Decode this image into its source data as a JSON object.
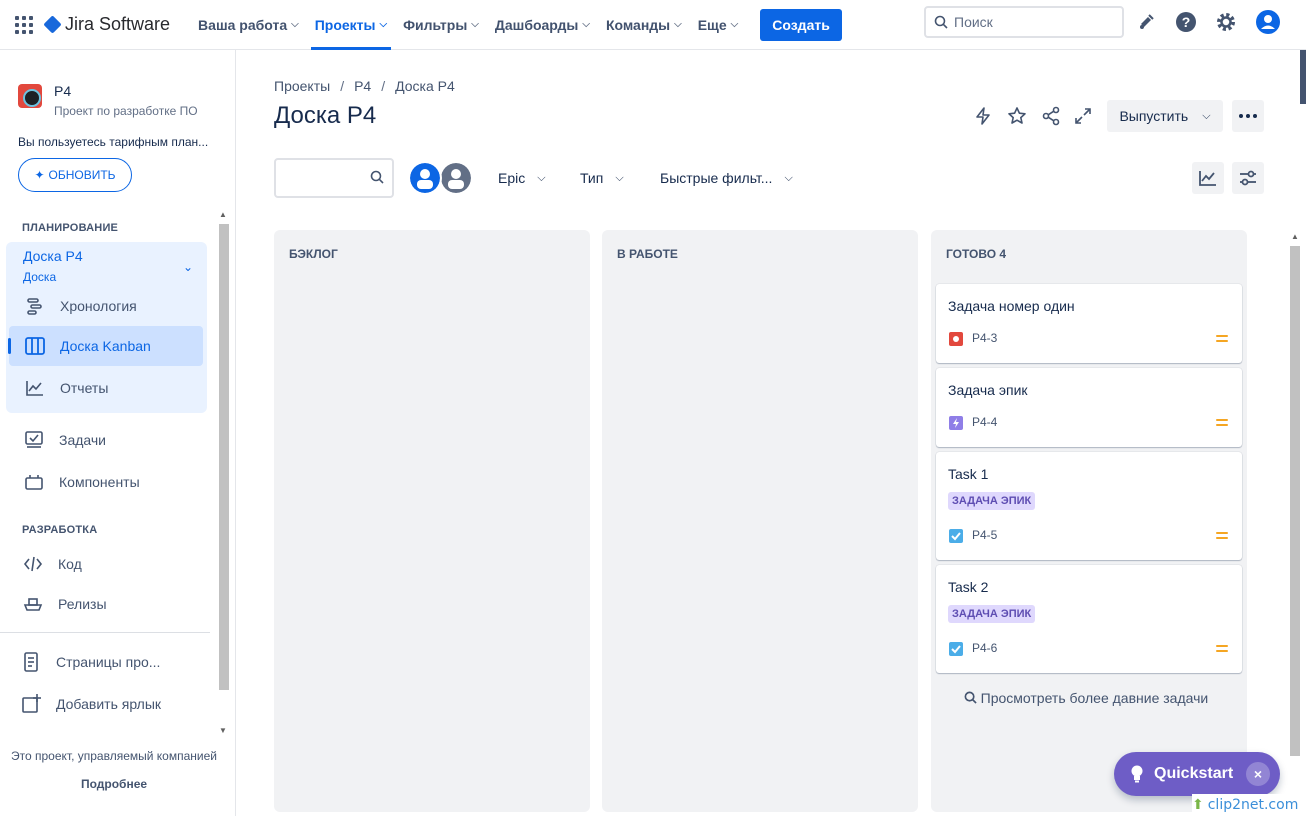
{
  "topnav": {
    "brand": "Jira Software",
    "menu": [
      {
        "label": "Ваша работа",
        "active": false
      },
      {
        "label": "Проекты",
        "active": true
      },
      {
        "label": "Фильтры",
        "active": false
      },
      {
        "label": "Дашбоарды",
        "active": false
      },
      {
        "label": "Команды",
        "active": false
      },
      {
        "label": "Еще",
        "active": false
      }
    ],
    "create_label": "Создать",
    "search_placeholder": "Поиск",
    "accent": "#0c66e4"
  },
  "sidebar": {
    "project_name": "P4",
    "project_type": "Проект по разработке ПО",
    "plan_note": "Вы пользуетесь тарифным план...",
    "upgrade_label": "ОБНОВИТЬ",
    "planning_label": "ПЛАНИРОВАНИЕ",
    "board_title": "Доска P4",
    "board_sub": "Доска",
    "planning_items": [
      {
        "label": "Хронология",
        "icon": "timeline-icon"
      },
      {
        "label": "Доска Kanban",
        "icon": "board-icon",
        "selected": true
      },
      {
        "label": "Отчеты",
        "icon": "reports-icon"
      }
    ],
    "other_items": [
      {
        "label": "Задачи",
        "icon": "issues-icon"
      },
      {
        "label": "Компоненты",
        "icon": "components-icon"
      }
    ],
    "development_label": "РАЗРАБОТКА",
    "dev_items": [
      {
        "label": "Код",
        "icon": "code-icon"
      },
      {
        "label": "Релизы",
        "icon": "releases-icon"
      }
    ],
    "bottom_items": [
      {
        "label": "Страницы про...",
        "icon": "pages-icon"
      },
      {
        "label": "Добавить ярлык",
        "icon": "add-shortcut-icon"
      }
    ],
    "footer_text": "Это проект, управляемый компанией",
    "footer_link": "Подробнее"
  },
  "main": {
    "breadcrumb": [
      "Проекты",
      "P4",
      "Доска P4"
    ],
    "title": "Доска P4",
    "release_label": "Выпустить",
    "filters": [
      "Epic",
      "Тип",
      "Быстрые фильт..."
    ],
    "columns": [
      {
        "title": "БЭКЛОГ",
        "cards": []
      },
      {
        "title": "В РАБОТЕ",
        "cards": []
      },
      {
        "title": "ГОТОВО 4",
        "cards": [
          {
            "title": "Задача номер один",
            "label": "",
            "key": "P4-3",
            "type": "bug",
            "color": "#e2483d"
          },
          {
            "title": "Задача эпик",
            "label": "",
            "key": "P4-4",
            "type": "epic",
            "color": "#8f7ee7"
          },
          {
            "title": "Task 1",
            "label": "ЗАДАЧА ЭПИК",
            "key": "P4-5",
            "type": "task",
            "color": "#4bade8"
          },
          {
            "title": "Task 2",
            "label": "ЗАДАЧА ЭПИК",
            "key": "P4-6",
            "type": "task",
            "color": "#4bade8"
          }
        ]
      }
    ],
    "older_link": "Просмотреть более давние задачи"
  },
  "quickstart": {
    "label": "Quickstart",
    "close": "×"
  },
  "watermark": "clip2net.com"
}
